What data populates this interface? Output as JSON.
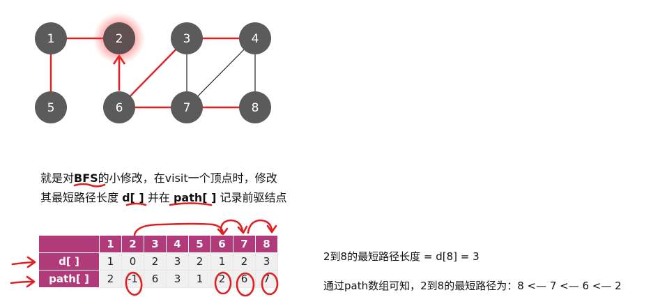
{
  "graph": {
    "nodes": [
      {
        "id": "1",
        "label": "1"
      },
      {
        "id": "2",
        "label": "2",
        "highlight": true
      },
      {
        "id": "3",
        "label": "3"
      },
      {
        "id": "4",
        "label": "4"
      },
      {
        "id": "5",
        "label": "5"
      },
      {
        "id": "6",
        "label": "6"
      },
      {
        "id": "7",
        "label": "7"
      },
      {
        "id": "8",
        "label": "8"
      }
    ],
    "node_color": "#5b5b5b",
    "highlight_color": "#ff3b3b",
    "tree_edge_color": "#e02020",
    "normal_edge_color": "#222222"
  },
  "description": {
    "line1_prefix": "就是对",
    "line1_bold": "BFS",
    "line1_suffix": "的小修改，在visit一个顶点时，修改",
    "line2_prefix": "其最短路径长度 ",
    "line2_bold1": "d[ ]",
    "line2_mid": " 并在 ",
    "line2_bold2": "path[ ]",
    "line2_suffix": " 记录前驱结点"
  },
  "table": {
    "headers": [
      "1",
      "2",
      "3",
      "4",
      "5",
      "6",
      "7",
      "8"
    ],
    "rows": [
      {
        "label": "d[ ]",
        "values": [
          "1",
          "0",
          "2",
          "3",
          "2",
          "1",
          "2",
          "3"
        ]
      },
      {
        "label": "path[ ]",
        "values": [
          "2",
          "-1",
          "6",
          "3",
          "1",
          "2",
          "6",
          "7"
        ]
      }
    ]
  },
  "info": {
    "line1": "2到8的最短路径长度 = d[8] = 3",
    "line2": "通过path数组可知，2到8的最短路径为：8  <—  7  <— 6  <—  2"
  },
  "accent_color": "#e02020"
}
